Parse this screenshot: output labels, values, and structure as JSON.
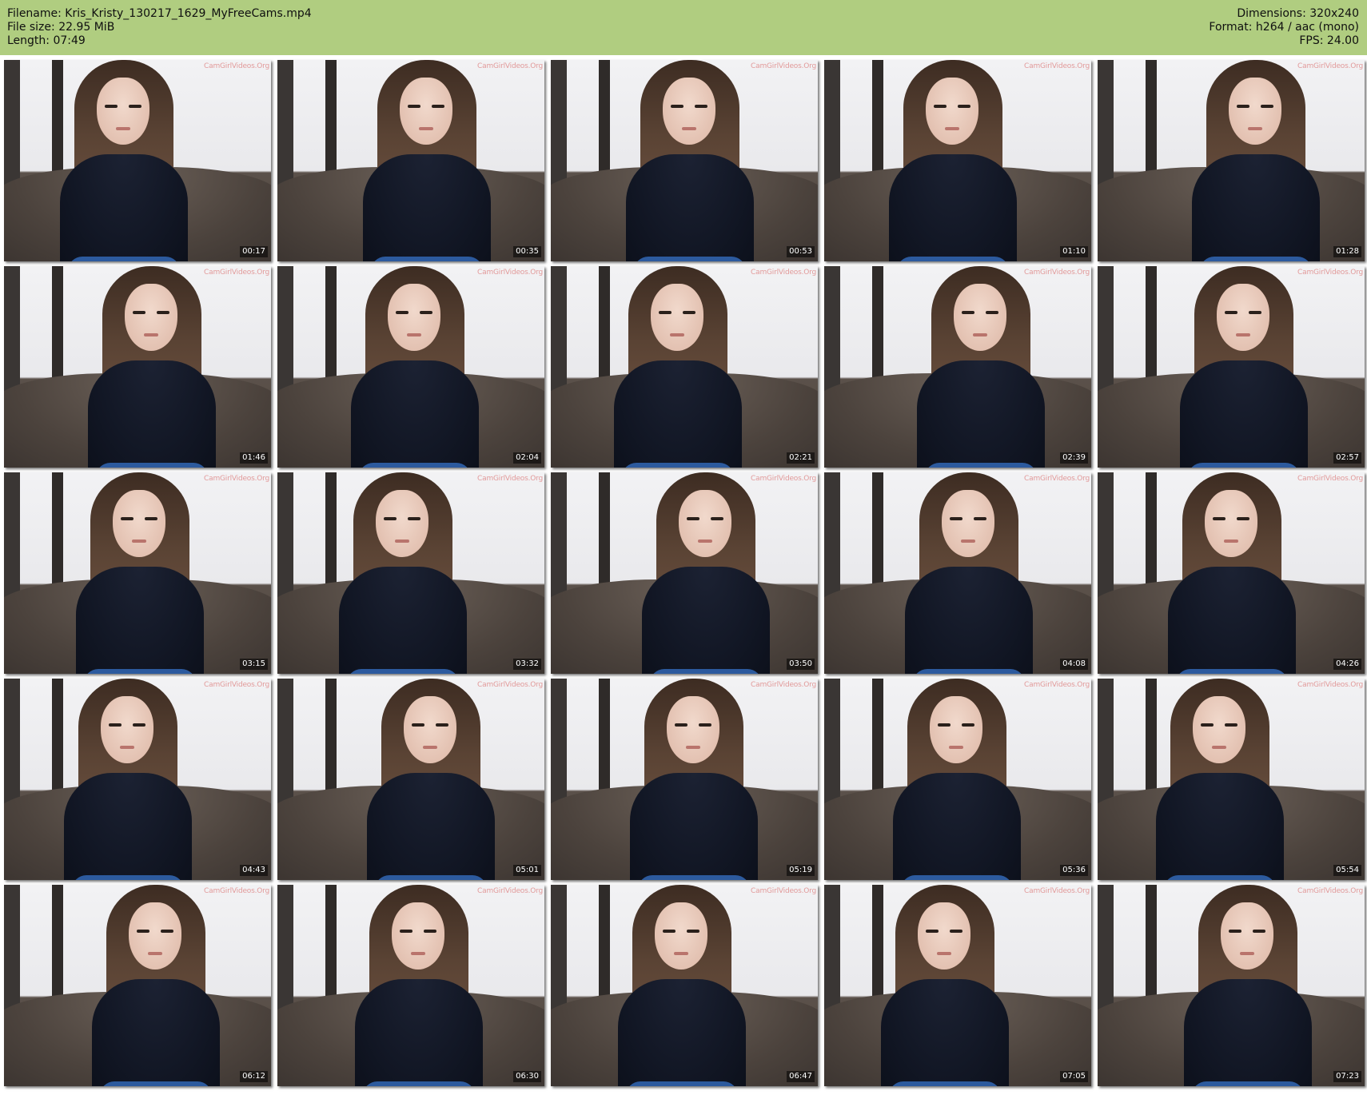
{
  "header": {
    "filename_line": "Filename: Kris_Kristy_130217_1629_MyFreeCams.mp4",
    "filesize_line": "File size: 22.95 MiB",
    "length_line": "Length: 07:49",
    "dimensions_line": "Dimensions: 320x240",
    "format_line": "Format: h264 / aac (mono)",
    "fps_line": "FPS: 24.00",
    "bg_color": "#b0cd80"
  },
  "thumbnails": {
    "watermark": "CamGirlVideos.Org",
    "timestamps": [
      "00:17",
      "00:35",
      "00:53",
      "01:10",
      "01:28",
      "01:46",
      "02:04",
      "02:21",
      "02:39",
      "02:57",
      "03:15",
      "03:32",
      "03:50",
      "04:08",
      "04:26",
      "04:43",
      "05:01",
      "05:19",
      "05:36",
      "05:54",
      "06:12",
      "06:30",
      "06:47",
      "07:05",
      "07:23"
    ]
  }
}
